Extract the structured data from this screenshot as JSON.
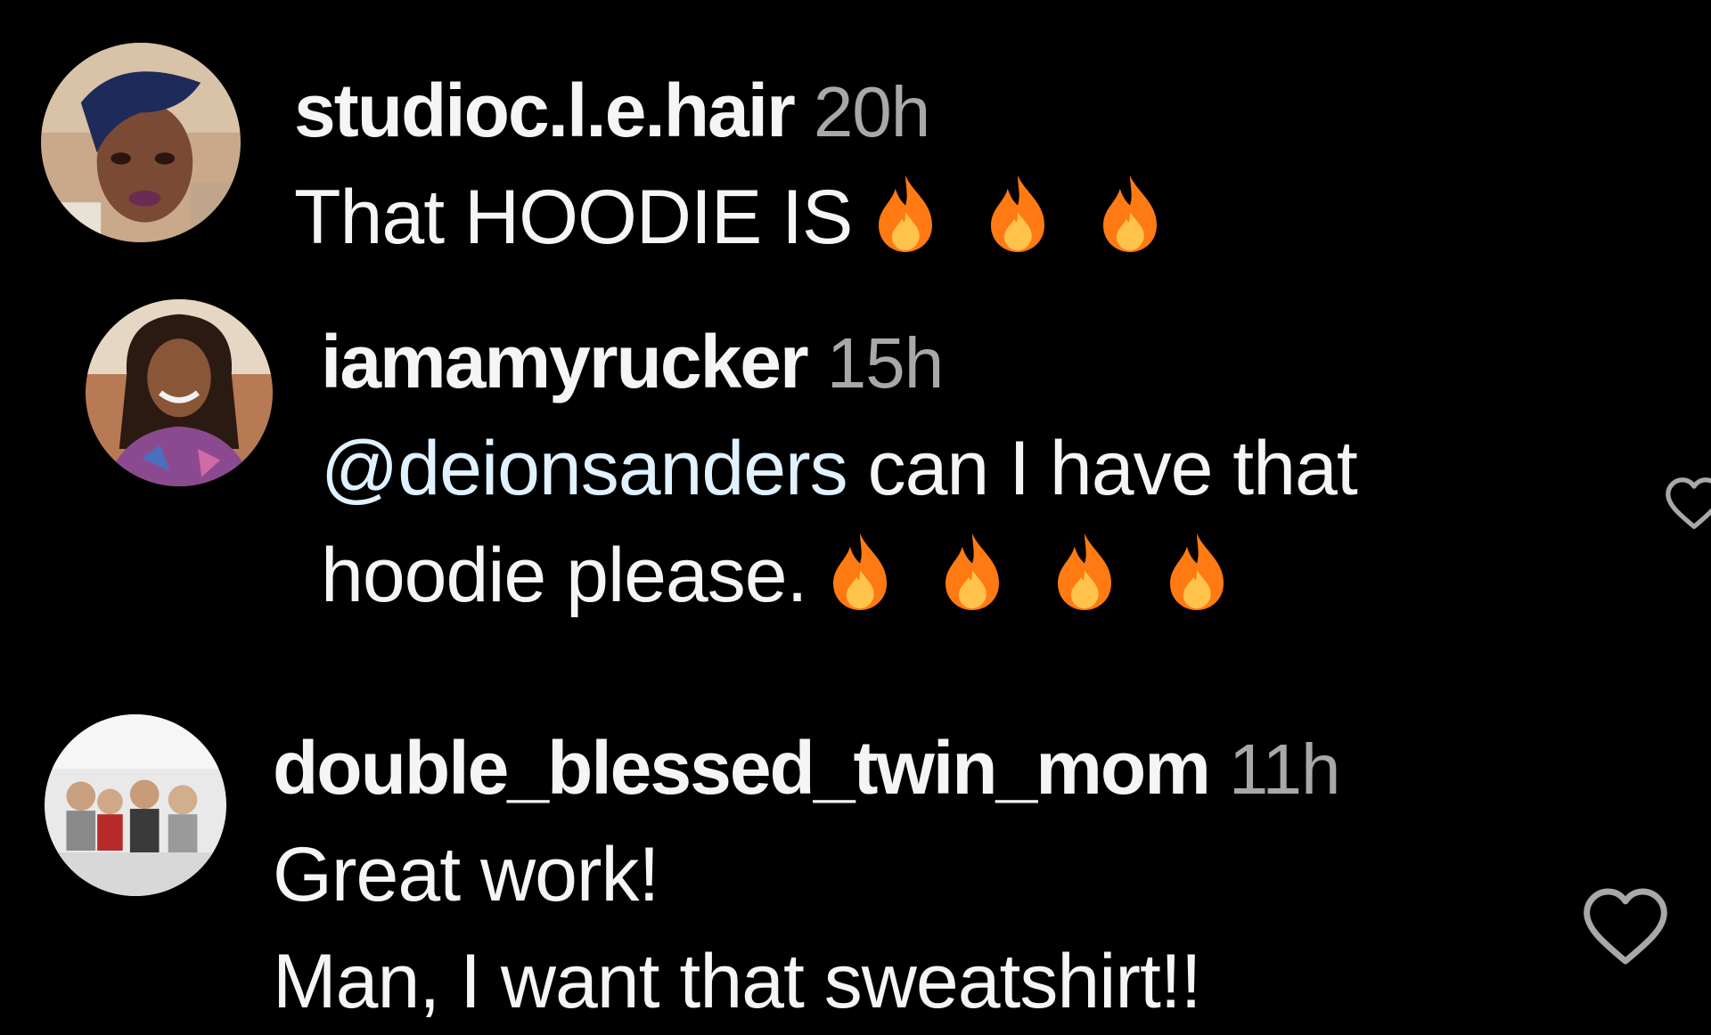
{
  "comments": [
    {
      "username": "studioc.l.e.hair",
      "time": "20h",
      "text": "That HOODIE IS",
      "emoji_count": 3,
      "emoji_icon": "fire-icon"
    },
    {
      "username": "iamamyrucker",
      "time": "15h",
      "mention": "@deionsanders",
      "text_rest": " can I have that",
      "text_line2": "hoodie please.",
      "emoji_count": 4,
      "emoji_icon": "fire-icon"
    },
    {
      "username": "double_blessed_twin_mom",
      "time": "11h",
      "text_line1": "Great work!",
      "text_line2": "Man, I want that sweatshirt!!"
    }
  ],
  "icons": {
    "like": "heart-outline-icon",
    "fire": "fire-icon"
  },
  "colors": {
    "background": "#000000",
    "text": "#f5f5f5",
    "secondary": "#a8a8a8",
    "mention": "#e0f1ff",
    "fire_outer": "#ff7a12",
    "fire_inner": "#ffc24a"
  }
}
